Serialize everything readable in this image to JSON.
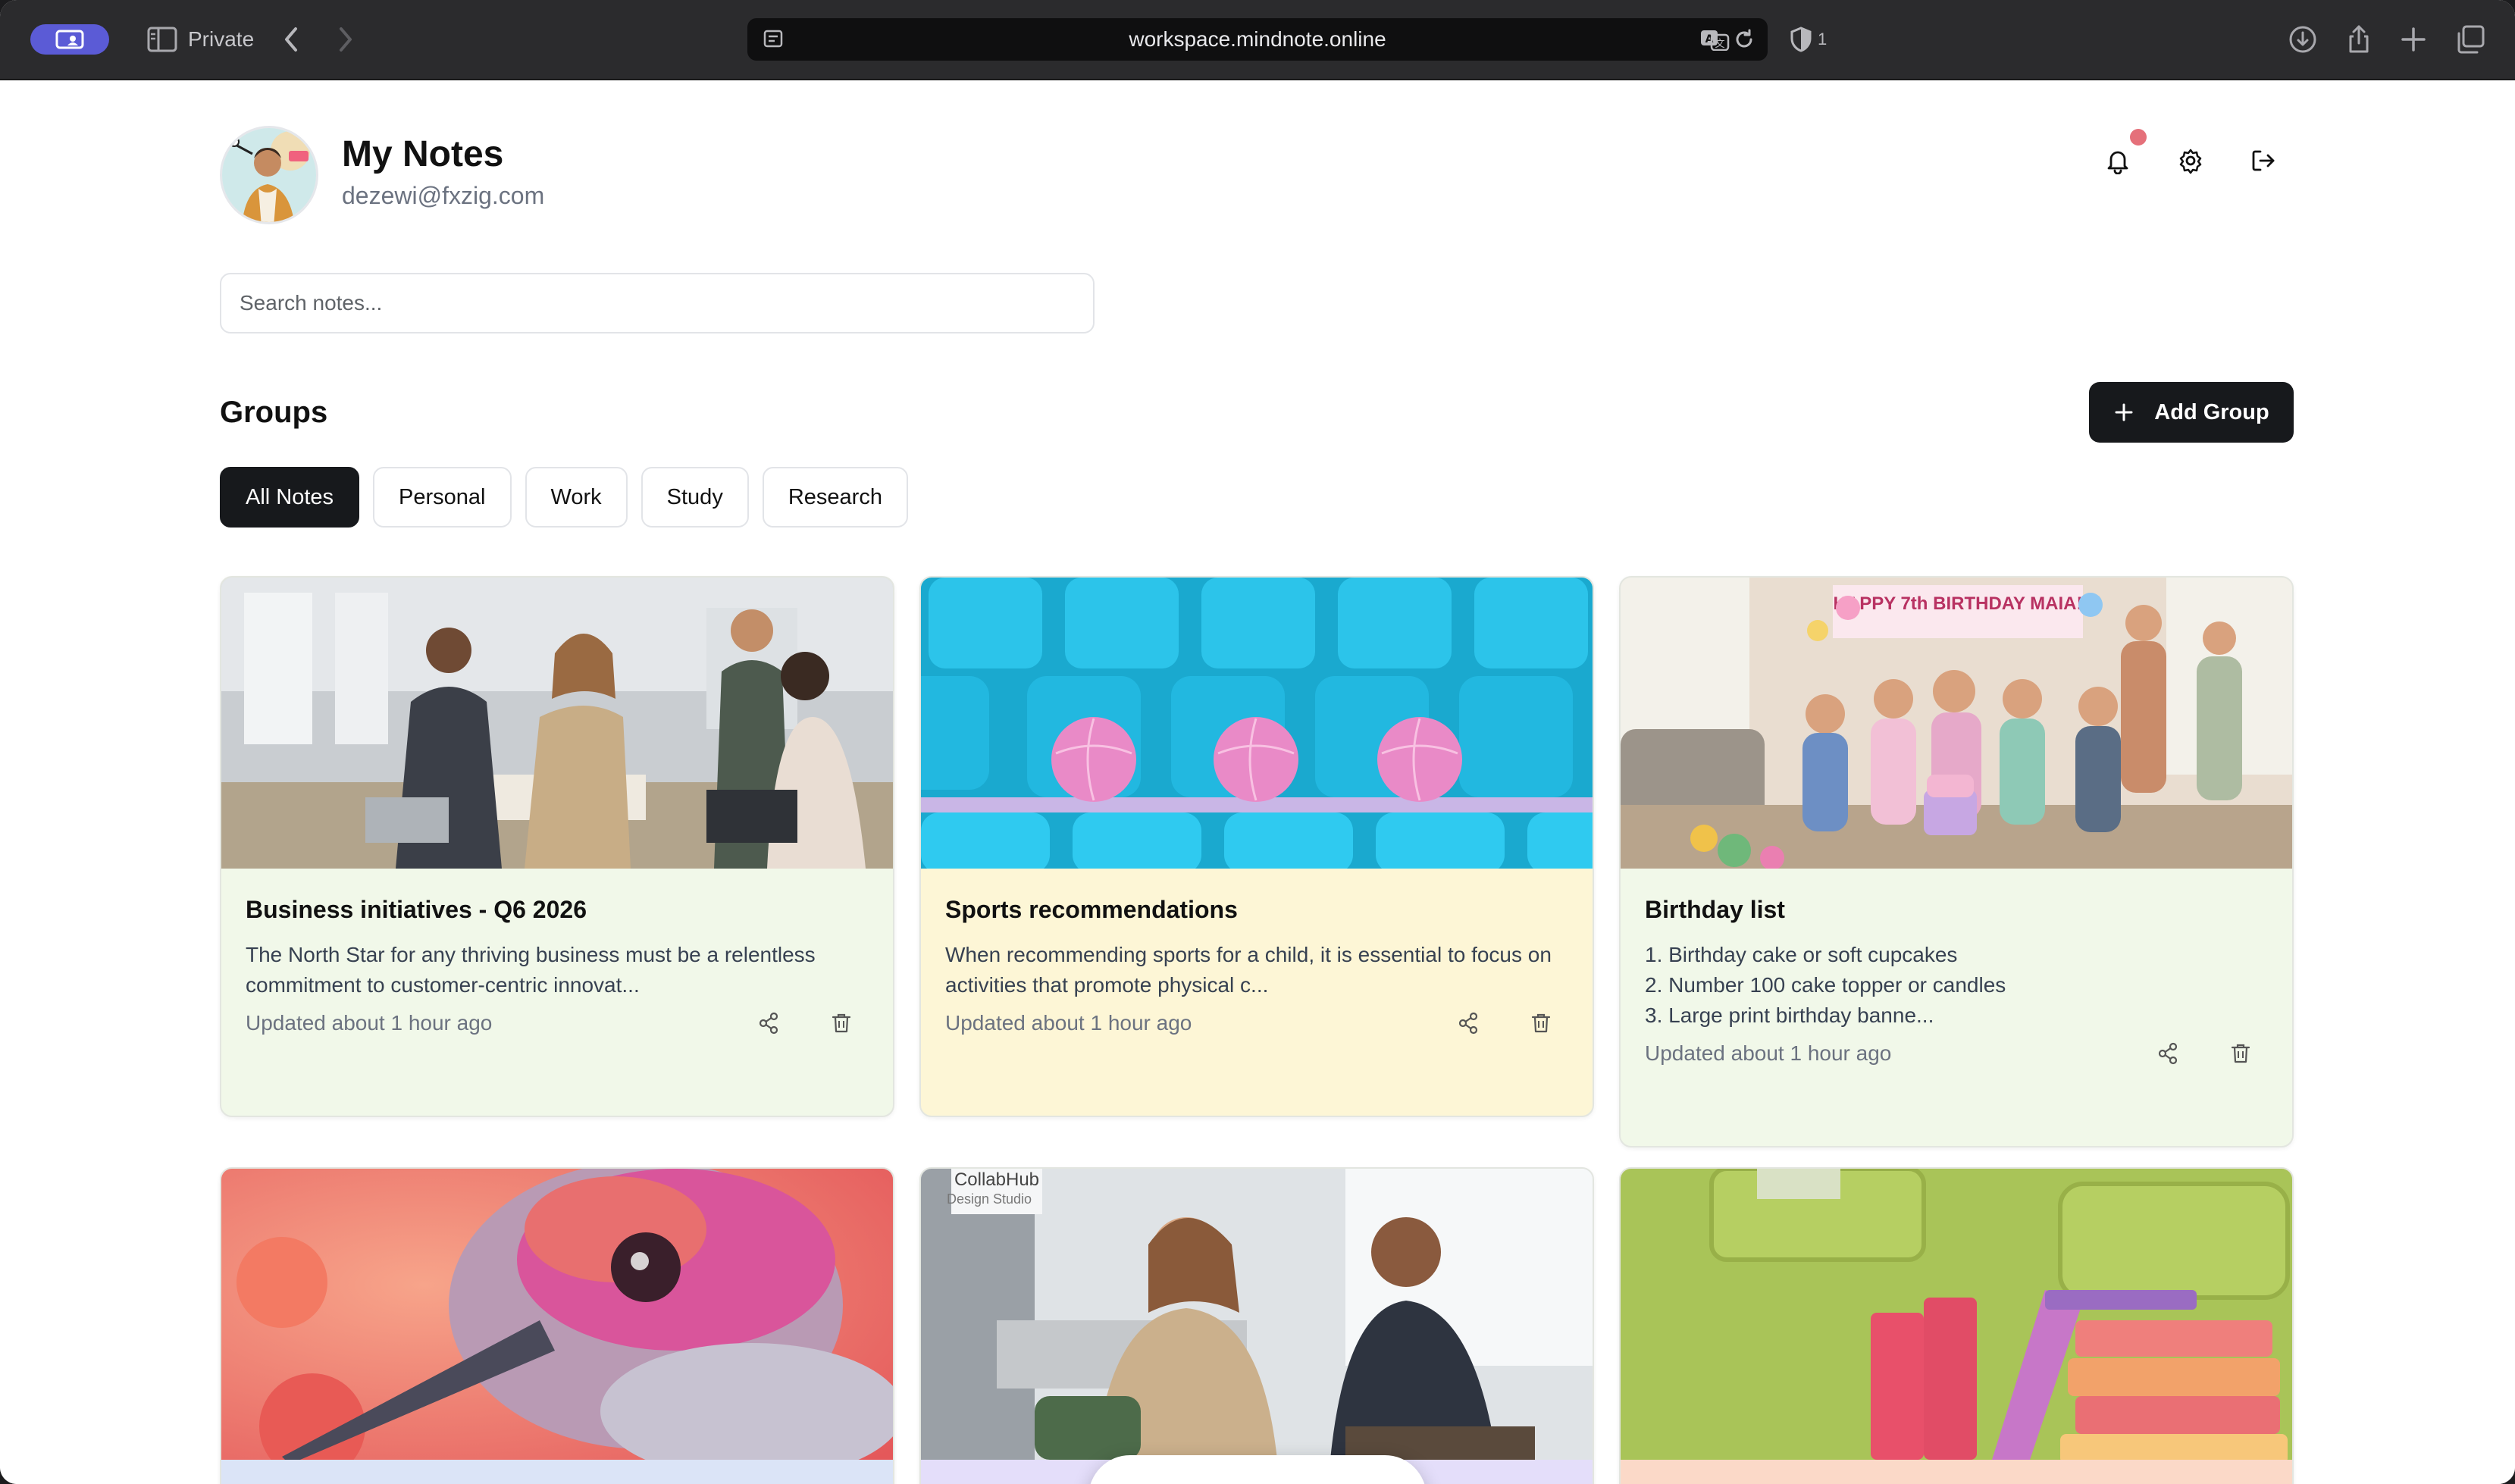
{
  "browser": {
    "private_label": "Private",
    "url": "workspace.mindnote.online",
    "shield_count": "1"
  },
  "header": {
    "title": "My Notes",
    "email": "dezewi@fxzig.com",
    "has_notification": true
  },
  "search": {
    "placeholder": "Search notes...",
    "value": ""
  },
  "groups": {
    "heading": "Groups",
    "add_label": "Add Group",
    "tabs": [
      {
        "label": "All Notes",
        "active": true
      },
      {
        "label": "Personal",
        "active": false
      },
      {
        "label": "Work",
        "active": false
      },
      {
        "label": "Study",
        "active": false
      },
      {
        "label": "Research",
        "active": false
      }
    ]
  },
  "notes": [
    {
      "title": "Business initiatives - Q6 2026",
      "excerpt": "The North Star for any thriving business must be a relentless commitment to customer-centric innovat...",
      "updated": "Updated about 1 hour ago",
      "color": "#f1f8e9",
      "image": "office team meeting"
    },
    {
      "title": "Sports recommendations",
      "excerpt": "When recommending sports for a child, it is essential to focus on activities that promote physical c...",
      "updated": "Updated about 1 hour ago",
      "color": "#fdf6d6",
      "image": "cyan stadium seats with pink balls"
    },
    {
      "title": "Birthday list",
      "excerpt": "1. Birthday cake or soft cupcakes\n2. Number 100 cake topper or candles\n3. Large print birthday banne...",
      "updated": "Updated about 1 hour ago",
      "color": "#f1f8e9",
      "image": "children birthday party",
      "banner_text": "HAPPY 7th BIRTHDAY MAIA!"
    },
    {
      "image": "hummingbird close-up",
      "color": "#dbe4f7"
    },
    {
      "image": "two colleagues talking in office",
      "sign_text": "CollabHub Design Studio",
      "color": "#e4defa"
    },
    {
      "image": "stack of books on green wall",
      "color": "#fbd9c8"
    }
  ],
  "colors": {
    "accent": "#17191c",
    "notification": "#e5707a",
    "browser_profile": "#5b5bd6"
  },
  "dock": {
    "icons": [
      "home-icon",
      "add-note-icon",
      "help-buoy-icon",
      "question-icon"
    ]
  }
}
